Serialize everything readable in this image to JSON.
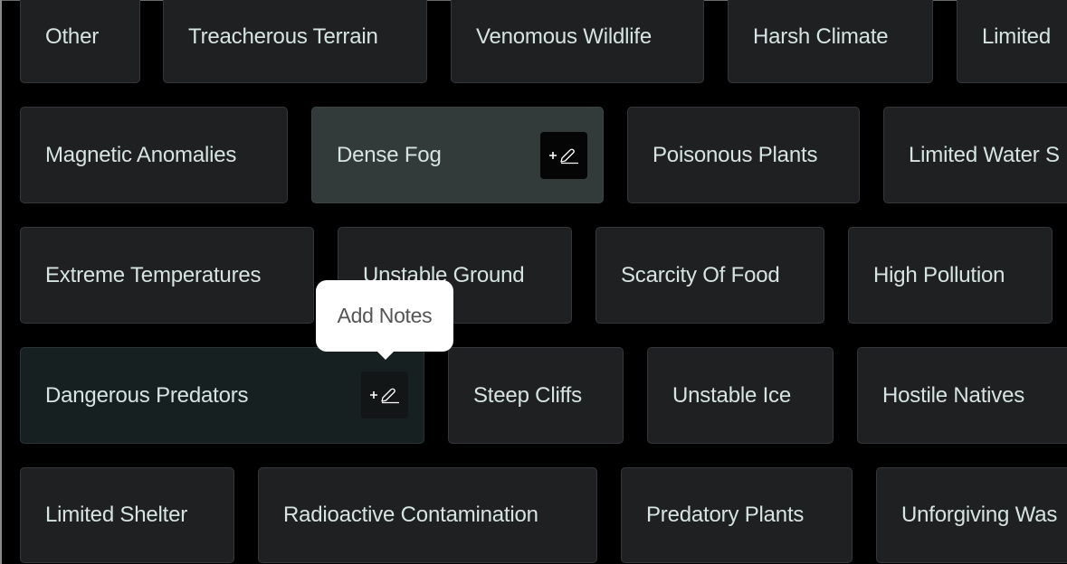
{
  "grid": {
    "rows": [
      [
        {
          "label": "Other",
          "state": "default"
        },
        {
          "label": "Treacherous Terrain",
          "state": "default"
        },
        {
          "label": "Venomous Wildlife",
          "state": "default"
        },
        {
          "label": "Harsh Climate",
          "state": "default"
        },
        {
          "label": "Limited",
          "state": "default"
        }
      ],
      [
        {
          "label": "Magnetic Anomalies",
          "state": "default"
        },
        {
          "label": "Dense Fog",
          "state": "hover",
          "action_icon": "add-note-icon"
        },
        {
          "label": "Poisonous Plants",
          "state": "default"
        },
        {
          "label": "Limited Water S",
          "state": "default"
        }
      ],
      [
        {
          "label": "Extreme Temperatures",
          "state": "default"
        },
        {
          "label": "Unstable Ground",
          "state": "default"
        },
        {
          "label": "Scarcity Of Food",
          "state": "default"
        },
        {
          "label": "High Pollution",
          "state": "default"
        }
      ],
      [
        {
          "label": "Dangerous Predators",
          "state": "selected",
          "action_icon": "add-note-icon"
        },
        {
          "label": "Steep Cliffs",
          "state": "default"
        },
        {
          "label": "Unstable Ice",
          "state": "default"
        },
        {
          "label": "Hostile Natives",
          "state": "default"
        }
      ],
      [
        {
          "label": "Limited Shelter",
          "state": "default"
        },
        {
          "label": "Radioactive Contamination",
          "state": "default"
        },
        {
          "label": "Predatory Plants",
          "state": "default"
        },
        {
          "label": "Unforgiving Was",
          "state": "default"
        }
      ]
    ]
  },
  "tooltip": {
    "text": "Add Notes"
  },
  "icons": {
    "add_note": {
      "plus": "+",
      "name": "add-note-icon"
    }
  },
  "colors": {
    "background": "#000000",
    "tile": "#1f2022",
    "tile_hover": "#323b3a",
    "tile_selected": "#172020",
    "text": "#d6e4e1",
    "tooltip_bg": "#ffffff",
    "tooltip_text": "#555555"
  }
}
